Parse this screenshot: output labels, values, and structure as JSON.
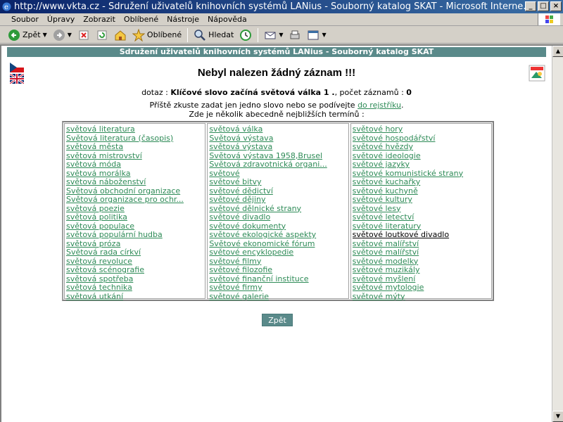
{
  "window": {
    "title": "http://www.vkta.cz - Sdružení uživatelů knihovních systémů LANius - Souborný katalog SKAT - Microsoft Interne...",
    "buttons": {
      "minimize": "_",
      "maximize": "□",
      "close": "×"
    }
  },
  "menu": [
    "Soubor",
    "Úpravy",
    "Zobrazit",
    "Oblíbené",
    "Nástroje",
    "Nápověda"
  ],
  "toolbar": {
    "back": "Zpět",
    "favorites": "Oblíbené",
    "search": "Hledat"
  },
  "page": {
    "banner": "Sdružení uživatelů knihovních systémů LANius - Souborný katalog SKAT",
    "heading": "Nebyl nalezen žádný záznam !!!",
    "query_prefix": "dotaz : ",
    "query_value": "Klíčové slovo začíná světová válka 1 .",
    "query_count_label": ", počet záznamů : ",
    "query_count": "0",
    "hint_text": "Příště zkuste zadat jen jedno slovo nebo se podívejte ",
    "hint_link": "do rejstříku",
    "hint_end": ".",
    "nearest_label": "Zde je několik abecedně nejbližších termínů :",
    "back_button": "Zpět"
  },
  "terms": {
    "col1": [
      "světová literatura",
      "Světová literatura (časopis)",
      "světová města",
      "světová mistrovství",
      "světová móda",
      "světová morálka",
      "světová náboženství",
      "Světová obchodní organizace",
      "Světová organizace pro ochr...",
      "světová poezie",
      "světová politika",
      "světová populace",
      "světová populární hudba",
      "světová próza",
      "Světová rada církví",
      "světová revoluce",
      "světová scénografie",
      "světová spotřeba",
      "světová technika",
      "světová utkání"
    ],
    "col2": [
      "světová válka",
      "Světová výstava",
      "světová výstava",
      "Světová výstava 1958,Brusel",
      "Světová zdravotnická organi...",
      "světové",
      "světové bitvy",
      "světové dědictví",
      "světové dějiny",
      "světové dělnické strany",
      "světové divadlo",
      "světové dokumenty",
      "světové ekologické aspekty",
      "Světové ekonomické fórum",
      "světové encyklopedie",
      "světové filmy",
      "světové filozofie",
      "světové finanční instituce",
      "světové firmy",
      "světové galerie"
    ],
    "col3": [
      "světové hory",
      "světové hospodářství",
      "světové hvězdy",
      "světové ideologie",
      "světové jazyky",
      "světové komunistické strany",
      "světové kuchařky",
      "světové kuchyně",
      "světové kultury",
      "světové lesy",
      "světové letectví",
      "světové literatury",
      "světové loutkové divadlo",
      "světové malířství",
      "světové malířství",
      "světové modelky",
      "světové muzikály",
      "světové myšlení",
      "světové mytologie",
      "světové mýty"
    ]
  },
  "colors": {
    "banner": "#5a8a8a",
    "link": "#2e8b57",
    "title_bar": "#0a246a"
  }
}
